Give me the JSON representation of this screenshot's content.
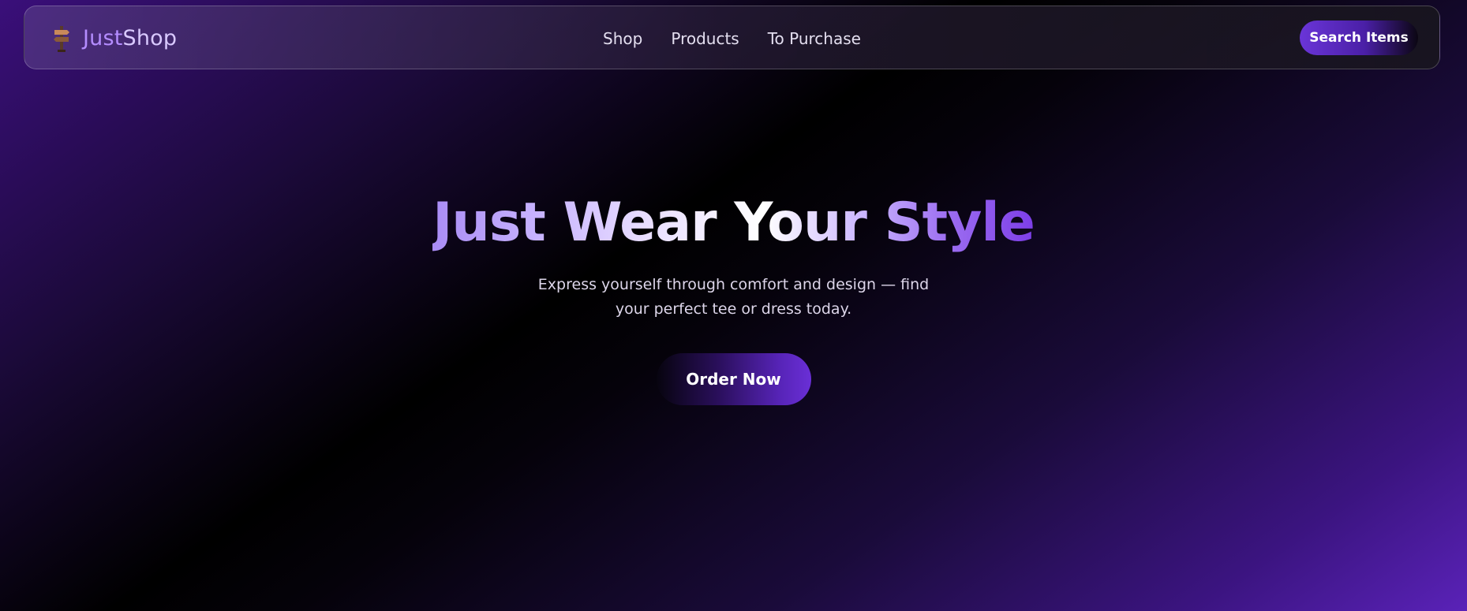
{
  "brand": {
    "name_prefix": "Just",
    "name_suffix": "Shop",
    "icon": "signpost-icon"
  },
  "nav": {
    "items": [
      {
        "label": "Shop"
      },
      {
        "label": "Products"
      },
      {
        "label": "To Purchase"
      }
    ],
    "search_label": "Search Items"
  },
  "hero": {
    "title": "Just Wear Your Style",
    "subtitle_line1": "Express yourself through comfort and design — find",
    "subtitle_line2": "your perfect tee or dress today.",
    "cta_label": "Order Now"
  },
  "colors": {
    "accent": "#6a35d8",
    "brand_text": "#b48cff",
    "background_dark": "#000000",
    "background_purple": "#5a22b8"
  }
}
